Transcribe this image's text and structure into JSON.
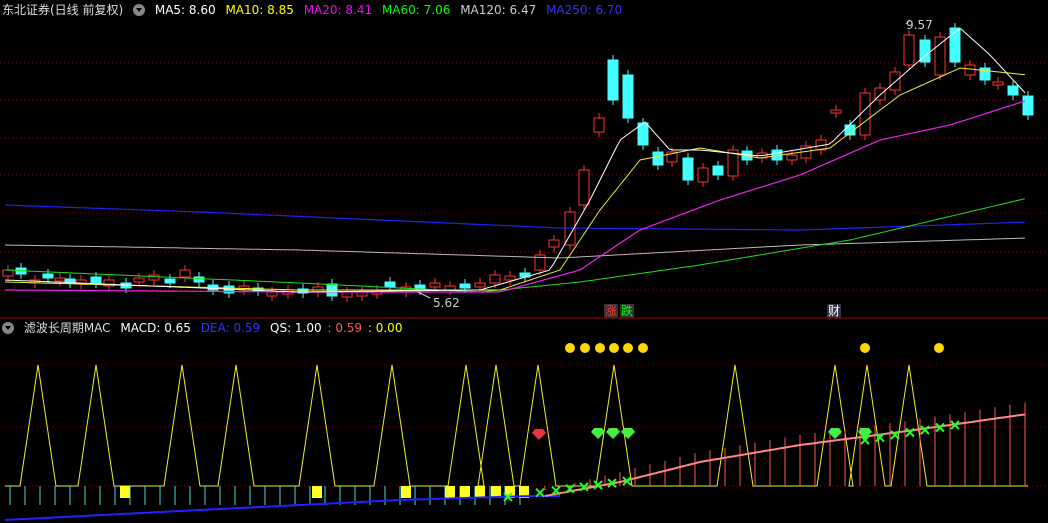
{
  "top_panel": {
    "security": "东北证券(日线 前复权)",
    "ma": [
      {
        "label": "MA5: 8.60",
        "color": "#ffffff"
      },
      {
        "label": "MA10: 8.85",
        "color": "#ffff00"
      },
      {
        "label": "MA20: 8.41",
        "color": "#ff00ff"
      },
      {
        "label": "MA60: 7.06",
        "color": "#00ff00"
      },
      {
        "label": "MA120: 6.47",
        "color": "#cccccc"
      },
      {
        "label": "MA250: 6.70",
        "color": "#3333ff"
      }
    ],
    "high_label": "9.57",
    "low_label": "5.62",
    "events": [
      {
        "text": "涨",
        "color": "#ff3333"
      },
      {
        "text": "跌",
        "color": "#00ff00"
      },
      {
        "text": "财",
        "color": "#ffffff"
      }
    ]
  },
  "bottom_panel": {
    "indicator_name": "滤波长周期MAC",
    "values": [
      {
        "label": "MACD: 0.65",
        "color": "#ffffff"
      },
      {
        "label": "DEA: 0.59",
        "color": "#3333ff"
      },
      {
        "label": "QS: 1.00",
        "color": "#ffffff"
      },
      {
        "label": ": 0.59",
        "color": "#ff5555"
      },
      {
        "label": ": 0.00",
        "color": "#ffff00"
      }
    ]
  },
  "colors": {
    "up": "#ff3333",
    "down": "#44ffff",
    "grid": "#8b0000",
    "background": "#000000"
  }
}
